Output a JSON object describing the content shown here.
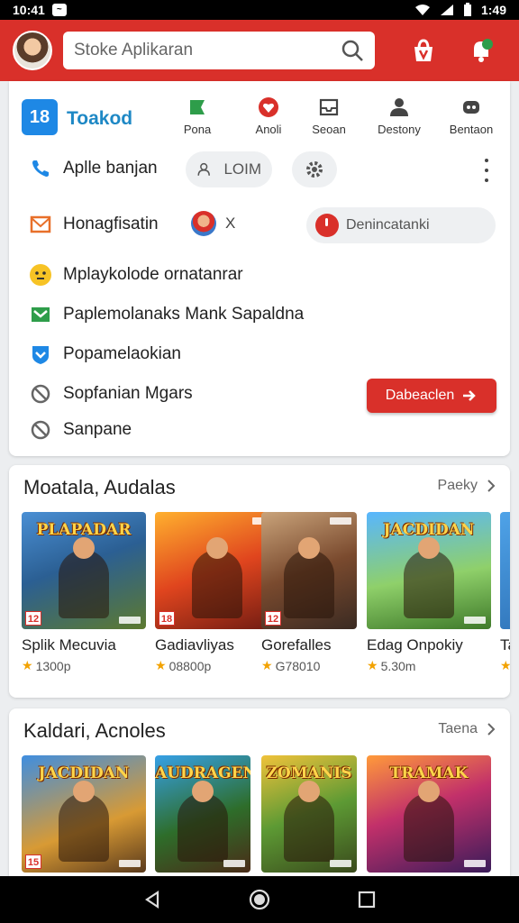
{
  "status_bar": {
    "time": "10:41",
    "right_time": "1:49"
  },
  "header": {
    "search_placeholder": "Stoke Aplikaran",
    "accent": "#d9302a"
  },
  "brand": {
    "logo_text": "18",
    "name": "Toakod"
  },
  "quick_actions": [
    {
      "label": "Pona",
      "icon": "flag-icon",
      "color": "#2e9d4a"
    },
    {
      "label": "Anoli",
      "icon": "heart-icon",
      "color": "#d9302a"
    },
    {
      "label": "Seoan",
      "icon": "inbox-icon",
      "color": "#444444"
    },
    {
      "label": "Destony",
      "icon": "people-icon",
      "color": "#444444"
    },
    {
      "label": "Bentaon",
      "icon": "robot-icon",
      "color": "#444444"
    }
  ],
  "menu": {
    "call_label": "Aplle banjan",
    "login_label": "LOIM",
    "history_label": "Honagfisatin",
    "x_label": "X",
    "deny_label": "Denincatanki",
    "playlist_label": "Mplaykolode ornatanrar",
    "paper_label": "Paplemolanaks Mank Sapaldna",
    "pop_label": "Popamelaokian",
    "sop_label": "Sopfanian Mgars",
    "san_label": "Sanpane",
    "download_label": "Dabeaclen"
  },
  "section1": {
    "title": "Moatala, Audalas",
    "more": "Paeky",
    "items": [
      {
        "name": "Splik Mecuvia",
        "rating": "1300p",
        "age": "12",
        "logo": "PLAPADAR",
        "bg": "linear-gradient(160deg,#4a8fd4 0%,#2b5f93 45%,#5d7a2f 100%)"
      },
      {
        "name": "Gadiavliyas",
        "rating": "08800p",
        "age": "18",
        "logo": "",
        "bg": "linear-gradient(160deg,#ffb02e 0%,#e0451e 50%,#6e1b12 100%)"
      },
      {
        "name": "Gorefalles",
        "rating": "G78010",
        "age": "12",
        "logo": "",
        "bg": "linear-gradient(160deg,#c9a37a 0%,#7a4a2e 50%,#3a2a22 100%)"
      },
      {
        "name": "Edag Onpokiy",
        "rating": "5.30m",
        "age": "",
        "logo": "JACDIDAN",
        "bg": "linear-gradient(170deg,#58b6ff 0%,#8fd06a 55%,#3f7a2a 100%)"
      },
      {
        "name": "Ta",
        "rating": "",
        "age": "",
        "logo": "",
        "bg": "linear-gradient(160deg,#4fa3e8 0%,#2a6bb0 100%)"
      }
    ]
  },
  "section2": {
    "title": "Kaldari, Acnoles",
    "more": "Taena",
    "items": [
      {
        "name": "",
        "rating": "",
        "age": "15",
        "logo": "JACDIDAN",
        "bg": "linear-gradient(160deg,#3f8ee0 0%,#d89a34 60%,#5a3a1c 100%)"
      },
      {
        "name": "",
        "rating": "",
        "age": "",
        "logo": "AUDRAGEN",
        "bg": "linear-gradient(160deg,#36a0e6 0%,#2e6d2a 55%,#4a2c18 100%)"
      },
      {
        "name": "",
        "rating": "",
        "age": "",
        "logo": "ZOMANIS",
        "bg": "linear-gradient(160deg,#f0c23a 0%,#5d9a34 50%,#3a4a1c 100%)"
      },
      {
        "name": "",
        "rating": "",
        "age": "",
        "logo": "TRAMAK",
        "bg": "linear-gradient(160deg,#ff9a3a 0%,#c2306a 45%,#3a1c5a 100%)"
      }
    ]
  }
}
